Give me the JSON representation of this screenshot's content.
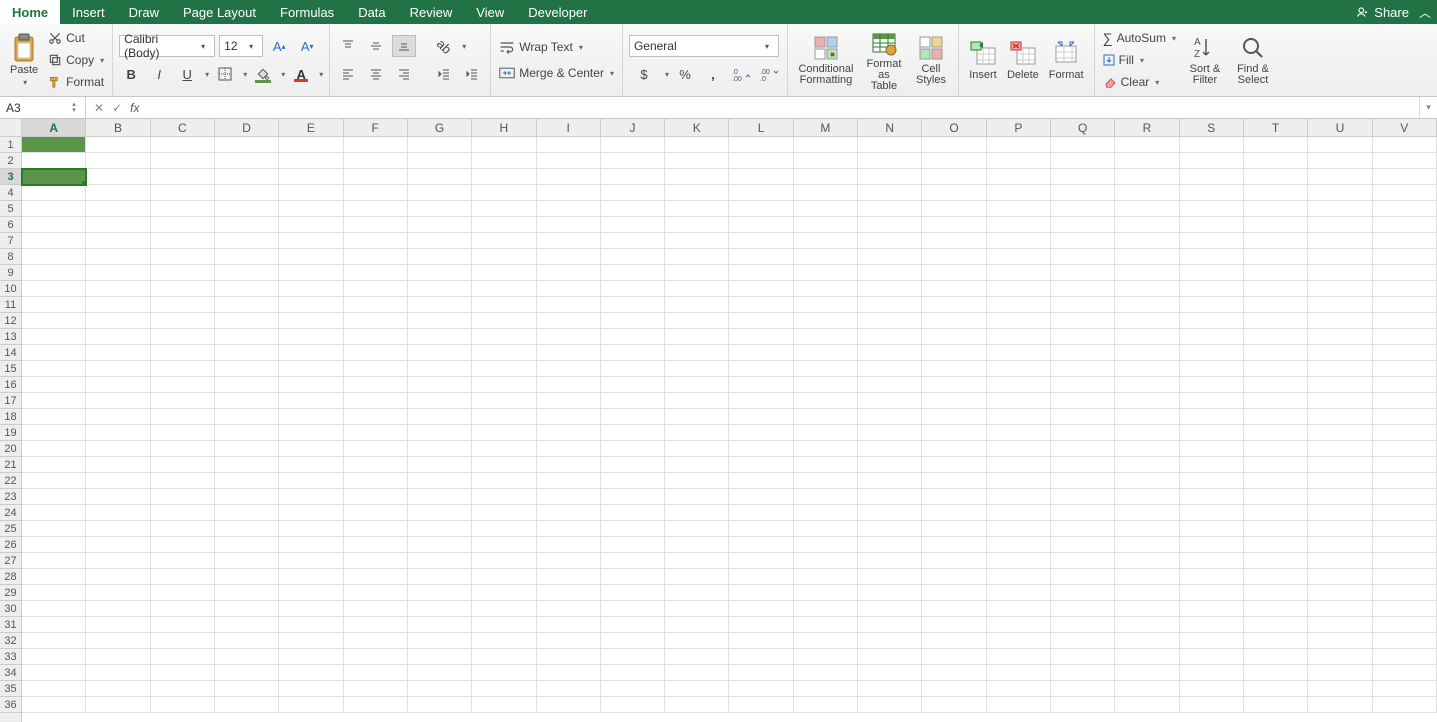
{
  "tabs": {
    "items": [
      "Home",
      "Insert",
      "Draw",
      "Page Layout",
      "Formulas",
      "Data",
      "Review",
      "View",
      "Developer"
    ],
    "active": "Home"
  },
  "share": {
    "label": "Share"
  },
  "clipboard": {
    "paste": "Paste",
    "cut": "Cut",
    "copy": "Copy",
    "format": "Format"
  },
  "font": {
    "name": "Calibri (Body)",
    "size": "12",
    "bold": "B",
    "italic": "I",
    "underline": "U"
  },
  "alignment": {
    "wrap": "Wrap Text",
    "merge": "Merge & Center"
  },
  "number": {
    "format": "General"
  },
  "styles": {
    "cond": "Conditional Formatting",
    "table": "Format as Table",
    "cell": "Cell Styles"
  },
  "cells": {
    "insert": "Insert",
    "delete": "Delete",
    "format": "Format"
  },
  "editing": {
    "autosum": "AutoSum",
    "fill": "Fill",
    "clear": "Clear",
    "sort": "Sort & Filter",
    "find": "Find & Select"
  },
  "namebox": {
    "value": "A3"
  },
  "formula": {
    "value": ""
  },
  "grid": {
    "columns": [
      "A",
      "B",
      "C",
      "D",
      "E",
      "F",
      "G",
      "H",
      "I",
      "J",
      "K",
      "L",
      "M",
      "N",
      "O",
      "P",
      "Q",
      "R",
      "S",
      "T",
      "U",
      "V"
    ],
    "rows": 36,
    "selected_col": "A",
    "selected_row": 3,
    "filled": {
      "A1": {
        "bg": "#5b9549"
      },
      "A3": {
        "bg": "#5b9549",
        "active": true
      }
    }
  }
}
